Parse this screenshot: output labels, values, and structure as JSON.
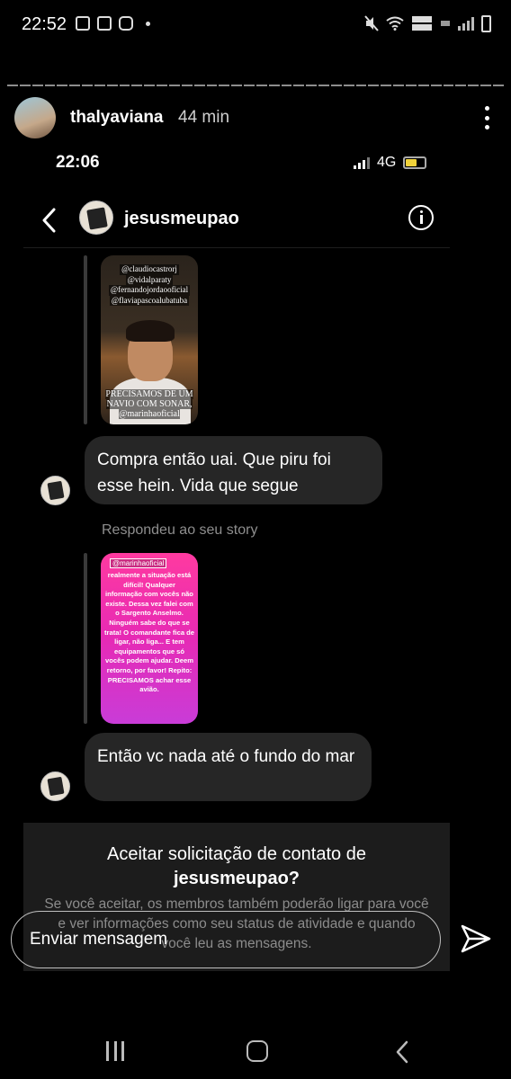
{
  "status_bar": {
    "time": "22:52"
  },
  "story": {
    "username": "thalyaviana",
    "time_ago": "44 min",
    "inner_status": {
      "time": "22:06",
      "network": "4G"
    },
    "chat": {
      "username": "jesusmeupao",
      "messages": [
        {
          "type": "story_reply",
          "story_tags": [
            "@claudiocastrorj",
            "@vidalparaty",
            "@fernandojordaooficial",
            "@flaviapascoalubatuba"
          ],
          "story_caption": "PRECISAMOS DE UM NAVIO COM SONAR, @marinhaoficial"
        },
        {
          "type": "text",
          "text": "Compra então uai. Que piru foi esse hein. Vida que segue"
        },
        {
          "type": "label",
          "text": "Respondeu ao seu story"
        },
        {
          "type": "story_reply",
          "story_tag": "@marinhaoficial",
          "story_text": "realmente a situação está difícil! Qualquer informação com vocês não existe. Dessa vez falei com o Sargento Anselmo. Ninguém sabe do que se trata! O comandante fica de ligar, não liga... E tem equipamentos que só vocês podem ajudar. Deem retorno, por favor! Repito: PRECISAMOS achar esse avião."
        },
        {
          "type": "text",
          "text": "Então vc nada até o fundo do mar"
        }
      ],
      "accept_request": {
        "title_prefix": "Aceitar solicitação de contato de",
        "title_user": "jesusmeupao?",
        "description": "Se você aceitar, os membros também poderão ligar para você e ver informações como seu status de atividade e quando você leu as mensagens."
      }
    }
  },
  "composer": {
    "placeholder": "Enviar mensagem"
  }
}
